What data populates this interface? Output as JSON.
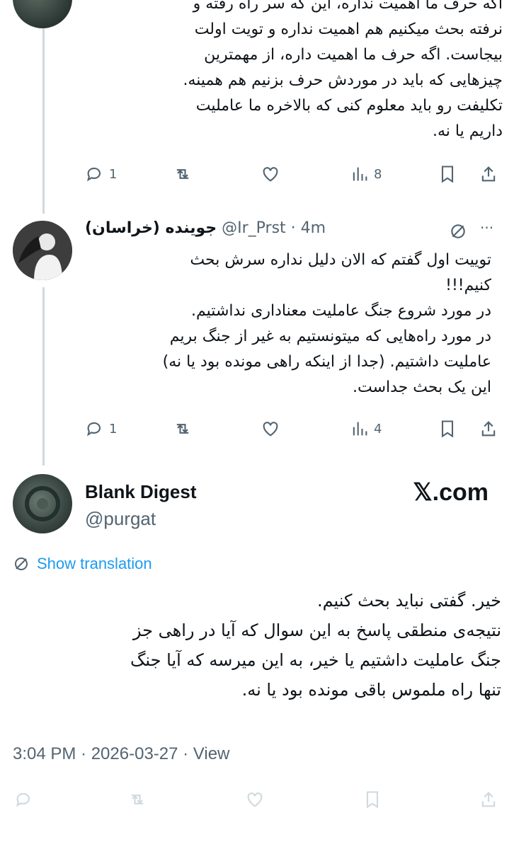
{
  "tweet1": {
    "text": "اگه حرف ما اهمیت نداره، این که سر راه رفته و\nنرفته بحث میکنیم هم اهمیت نداره و تویت اولت\nبیجاست. اگه حرف ما اهمیت داره، از مهمترین\nچیزهایی که باید در موردش حرف بزنیم هم همینه.\nتکلیفت رو باید معلوم کنی که بالاخره ما عاملیت\nداریم یا نه.",
    "replies": "1",
    "views": "8"
  },
  "tweet2": {
    "name": "جوینده (خراسان)",
    "handle": "@Ir_Prst",
    "dot": "·",
    "time": "4m",
    "more": "···",
    "text": "توییت اول گفتم که الان دلیل نداره سرش بحث\nکنیم!!!\nدر مورد شروع جنگ عاملیت معناداری نداشتیم.\nدر مورد راه‌هایی که میتونستیم به غیر از جنگ بریم\nعاملیت داشتیم. (جدا از اینکه راهی مونده بود یا نه)\nاین یک بحث جداست.",
    "replies": "1",
    "views": "4"
  },
  "main": {
    "name": "Blank Digest",
    "handle": "@purgat",
    "brand": "𝕏.com",
    "show_translation": "Show translation",
    "text": "خیر. گفتی نباید بحث کنیم.\nنتیجه‌ی منطقی پاسخ به این سوال که آیا در راهی جز\nجنگ عاملیت داشتیم یا خیر، به این میرسه که آیا جنگ\nتنها راه ملموس باقی مونده بود یا نه.",
    "timestamp": "3:04 PM · 2026-03-27 · View"
  },
  "colors": {
    "text": "#0f1419",
    "secondary": "#536471",
    "link": "#1d9bf0",
    "thread": "#cfd9de"
  }
}
